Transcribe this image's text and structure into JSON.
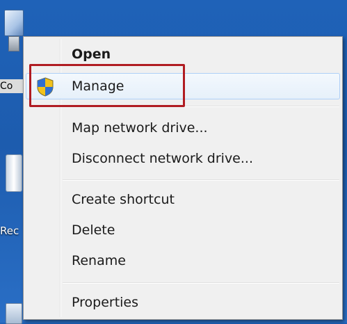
{
  "desktop": {
    "icon1_label": "Co",
    "icon2_label": "Rec"
  },
  "context_menu": {
    "items": [
      {
        "label": "Open",
        "default": true
      },
      {
        "label": "Manage",
        "icon": "uac-shield-icon",
        "highlighted": true
      },
      {
        "label": "Map network drive..."
      },
      {
        "label": "Disconnect network drive..."
      },
      {
        "label": "Create shortcut"
      },
      {
        "label": "Delete"
      },
      {
        "label": "Rename"
      },
      {
        "label": "Properties"
      }
    ]
  },
  "colors": {
    "desktop_background": "#1f62b8",
    "menu_background": "#f0f0f0",
    "hover_background": "#e6f0fa",
    "hover_border": "#aecff7",
    "annotation_box": "#b01c22"
  }
}
